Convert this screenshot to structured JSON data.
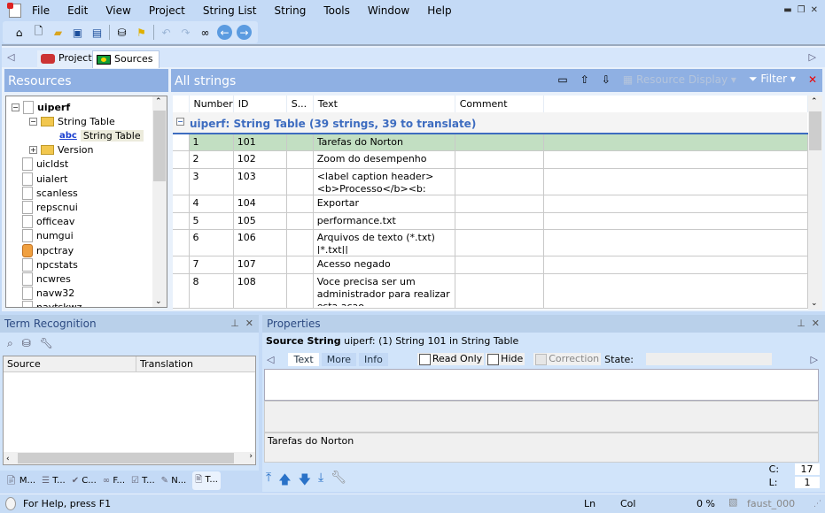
{
  "menu": [
    "File",
    "Edit",
    "View",
    "Project",
    "String List",
    "String",
    "Tools",
    "Window",
    "Help"
  ],
  "tabs": {
    "project": "Project",
    "sources": "Sources"
  },
  "resources": {
    "title": "Resources",
    "tree": [
      {
        "label": "uiperf",
        "bold": true
      },
      {
        "label": "String Table"
      },
      {
        "label": "String Table",
        "selected": true,
        "icon": "abc"
      },
      {
        "label": "Version"
      },
      {
        "label": "uicldst"
      },
      {
        "label": "uialert"
      },
      {
        "label": "scanless"
      },
      {
        "label": "repscnui"
      },
      {
        "label": "officeav"
      },
      {
        "label": "numgui"
      },
      {
        "label": "npctray"
      },
      {
        "label": "npcstats"
      },
      {
        "label": "ncwres"
      },
      {
        "label": "navw32"
      },
      {
        "label": "navtskwz"
      }
    ]
  },
  "strings": {
    "title": "All strings",
    "resource_display": "Resource Display",
    "filter": "Filter",
    "columns": [
      "Number",
      "ID",
      "S...",
      "Text",
      "Comment"
    ],
    "group": "uiperf: String Table  (39 strings, 39 to translate)",
    "rows": [
      {
        "n": "1",
        "id": "101",
        "text": "Tarefas do Norton"
      },
      {
        "n": "2",
        "id": "102",
        "text": "Zoom do desempenho"
      },
      {
        "n": "3",
        "id": "103",
        "text": "<label caption header><b>Processo</b><b:"
      },
      {
        "n": "4",
        "id": "104",
        "text": "Exportar"
      },
      {
        "n": "5",
        "id": "105",
        "text": "performance.txt"
      },
      {
        "n": "6",
        "id": "106",
        "text": "Arquivos de texto (*.txt) |*.txt||"
      },
      {
        "n": "7",
        "id": "107",
        "text": "Acesso negado"
      },
      {
        "n": "8",
        "id": "108",
        "text": "Voce precisa ser um administrador para realizar esta acao"
      }
    ]
  },
  "term": {
    "title": "Term Recognition",
    "col_source": "Source",
    "col_translation": "Translation"
  },
  "bottom_tabs": [
    "M...",
    "T...",
    "C...",
    "F...",
    "T...",
    "N...",
    "T..."
  ],
  "props": {
    "title": "Properties",
    "source_label": "Source String",
    "source_value": "uiperf: (1) String 101 in String Table",
    "tabs": [
      "Text",
      "More",
      "Info"
    ],
    "read_only": "Read Only",
    "hide": "Hide",
    "correction": "Correction",
    "state": "State:",
    "text": "Tarefas do Norton",
    "c_label": "C:",
    "c_value": "17",
    "l_label": "L:",
    "l_value": "1"
  },
  "status": {
    "help": "For Help, press F1",
    "ln": "Ln",
    "col": "Col",
    "percent": "0 %",
    "user": "faust_000"
  },
  "colors": {
    "accent": "#8fb0e3",
    "selection": "#c2dfc2",
    "group": "#3d6cc0"
  }
}
